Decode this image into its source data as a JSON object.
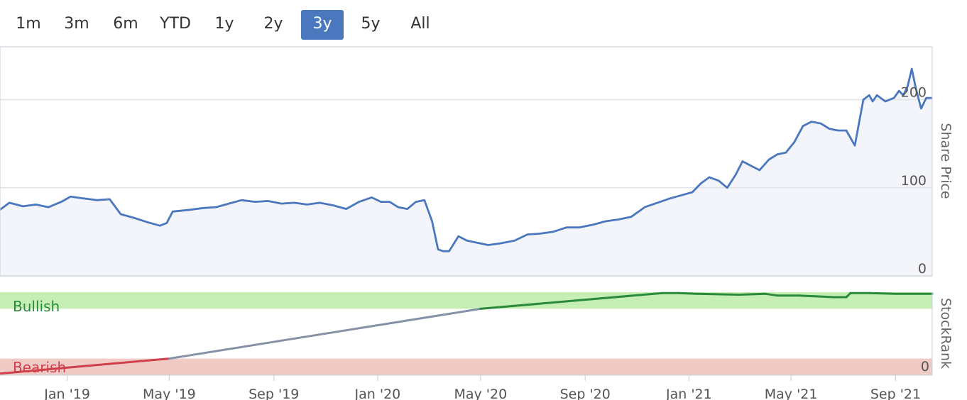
{
  "range_selector": {
    "buttons": [
      {
        "label": "1m",
        "active": false
      },
      {
        "label": "3m",
        "active": false
      },
      {
        "label": "6m",
        "active": false
      },
      {
        "label": "YTD",
        "active": false
      },
      {
        "label": "1y",
        "active": false
      },
      {
        "label": "2y",
        "active": false
      },
      {
        "label": "3y",
        "active": true
      },
      {
        "label": "5y",
        "active": false
      },
      {
        "label": "All",
        "active": false
      }
    ]
  },
  "colors": {
    "price_line": "#4a77bd",
    "bullish_band": "#c6efb6",
    "bearish_band": "#f0cbc6",
    "bullish_text": "#2a8a3a",
    "bearish_text": "#d0404a",
    "rank_line_green": "#2a8a3a",
    "rank_line_grey": "#8592a6",
    "rank_line_red": "#d0404a",
    "active_button": "#4a77bd"
  },
  "chart_data": [
    {
      "type": "line",
      "title": "",
      "ylabel": "Share Price",
      "y_ticks": [
        "0",
        "100",
        "200"
      ],
      "ylim": [
        0,
        260
      ],
      "x_range": [
        "2018-10-14",
        "2021-10-14"
      ],
      "grid": true,
      "series": [
        {
          "x": [
            "2018-10-14",
            "2018-10-25",
            "2018-11-10",
            "2018-11-25",
            "2018-12-10",
            "2018-12-25",
            "2019-01-05",
            "2019-01-20",
            "2019-02-05",
            "2019-02-20",
            "2019-03-05",
            "2019-03-20",
            "2019-04-05",
            "2019-04-20",
            "2019-04-28",
            "2019-05-05",
            "2019-05-25",
            "2019-06-10",
            "2019-06-25",
            "2019-07-10",
            "2019-07-25",
            "2019-08-10",
            "2019-08-25",
            "2019-09-10",
            "2019-09-25",
            "2019-10-10",
            "2019-10-25",
            "2019-11-10",
            "2019-11-25",
            "2019-12-10",
            "2019-12-25",
            "2020-01-05",
            "2020-01-15",
            "2020-01-25",
            "2020-02-05",
            "2020-02-15",
            "2020-02-25",
            "2020-03-05",
            "2020-03-12",
            "2020-03-18",
            "2020-03-25",
            "2020-04-05",
            "2020-04-15",
            "2020-04-25",
            "2020-05-10",
            "2020-05-25",
            "2020-06-10",
            "2020-06-25",
            "2020-07-10",
            "2020-07-25",
            "2020-08-10",
            "2020-08-25",
            "2020-09-10",
            "2020-09-25",
            "2020-10-10",
            "2020-10-25",
            "2020-11-10",
            "2020-11-25",
            "2020-12-10",
            "2020-12-25",
            "2021-01-05",
            "2021-01-15",
            "2021-01-25",
            "2021-02-05",
            "2021-02-15",
            "2021-02-25",
            "2021-03-05",
            "2021-03-15",
            "2021-03-25",
            "2021-04-05",
            "2021-04-15",
            "2021-04-25",
            "2021-05-05",
            "2021-05-15",
            "2021-05-25",
            "2021-06-05",
            "2021-06-15",
            "2021-06-25",
            "2021-07-05",
            "2021-07-15",
            "2021-07-25",
            "2021-08-01",
            "2021-08-05",
            "2021-08-10",
            "2021-08-20",
            "2021-08-30",
            "2021-09-05",
            "2021-09-10",
            "2021-09-15",
            "2021-09-20",
            "2021-09-25",
            "2021-10-01",
            "2021-10-07",
            "2021-10-14"
          ],
          "values": [
            75,
            83,
            79,
            81,
            78,
            84,
            90,
            88,
            86,
            87,
            70,
            66,
            61,
            57,
            60,
            73,
            75,
            77,
            78,
            82,
            86,
            84,
            85,
            82,
            83,
            81,
            83,
            80,
            76,
            84,
            89,
            84,
            84,
            78,
            76,
            84,
            86,
            62,
            30,
            28,
            28,
            45,
            40,
            38,
            35,
            37,
            40,
            47,
            48,
            50,
            55,
            55,
            58,
            62,
            64,
            67,
            78,
            83,
            88,
            92,
            95,
            105,
            112,
            108,
            100,
            115,
            130,
            125,
            120,
            132,
            138,
            140,
            152,
            170,
            175,
            173,
            167,
            165,
            165,
            148,
            200,
            205,
            198,
            205,
            198,
            202,
            210,
            205,
            215,
            235,
            212,
            190,
            202,
            202
          ]
        }
      ]
    },
    {
      "type": "line",
      "title": "",
      "ylabel": "StockRank",
      "y_ticks": [
        "0"
      ],
      "ylim": [
        0,
        100
      ],
      "x_range": [
        "2018-10-14",
        "2021-10-14"
      ],
      "x_ticks": [
        "Jan '19",
        "May '19",
        "Sep '19",
        "Jan '20",
        "May '20",
        "Sep '20",
        "Jan '21",
        "May '21",
        "Sep '21"
      ],
      "bands": [
        {
          "label": "Bullish",
          "from": 80,
          "to": 100
        },
        {
          "label": "Bearish",
          "from": 0,
          "to": 20
        }
      ],
      "series": [
        {
          "x": [
            "2018-10-14",
            "2019-05-01",
            "2020-05-01",
            "2020-12-01",
            "2020-12-20",
            "2021-01-10",
            "2021-03-01",
            "2021-04-01",
            "2021-04-15",
            "2021-05-10",
            "2021-06-01",
            "2021-06-20",
            "2021-07-05",
            "2021-07-10",
            "2021-08-01",
            "2021-09-01",
            "2021-10-14"
          ],
          "values": [
            2,
            20,
            80,
            99,
            99,
            98,
            97,
            98,
            96,
            96,
            95,
            94,
            94,
            99,
            99,
            98,
            98
          ]
        }
      ]
    }
  ]
}
